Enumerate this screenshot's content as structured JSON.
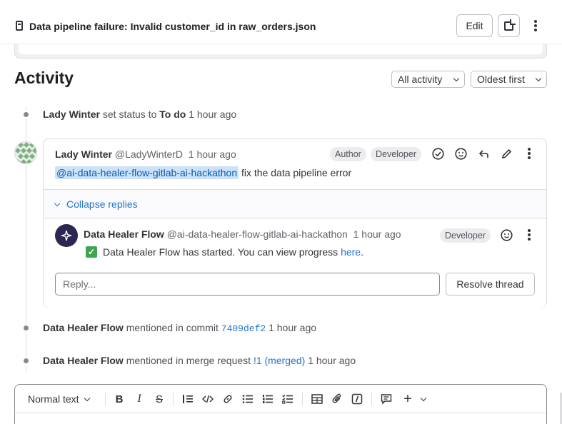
{
  "header": {
    "issue_title": "Data pipeline failure: Invalid customer_id in raw_orders.json",
    "edit_label": "Edit"
  },
  "activity": {
    "title": "Activity",
    "filter_value": "All activity",
    "sort_value": "Oldest first"
  },
  "timeline": {
    "status_note": {
      "author": "Lady Winter",
      "action": "set status to",
      "status": "To do",
      "time": "1 hour ago"
    },
    "discussion": {
      "author": "Lady Winter",
      "handle": "@LadyWinterD",
      "time": "1 hour ago",
      "badges": [
        "Author",
        "Developer"
      ],
      "mention": "@ai-data-healer-flow-gitlab-ai-hackathon",
      "body": "fix the data pipeline error",
      "collapse_label": "Collapse replies",
      "reply": {
        "author": "Data Healer Flow",
        "handle": "@ai-data-healer-flow-gitlab-ai-hackathon",
        "time": "1 hour ago",
        "badge": "Developer",
        "check": "✓",
        "body": "Data Healer Flow has started. You can view progress",
        "link": "here",
        "period": "."
      },
      "reply_placeholder": "Reply...",
      "resolve_label": "Resolve thread"
    },
    "commit_note": {
      "author": "Data Healer Flow",
      "action": "mentioned in commit",
      "commit": "7409def2",
      "time": "1 hour ago"
    },
    "mr_note": {
      "author": "Data Healer Flow",
      "action": "mentioned in merge request",
      "mr": "!1 (merged)",
      "time": "1 hour ago"
    }
  },
  "editor": {
    "text_style": "Normal text",
    "tools": [
      "bold-icon",
      "italic-icon",
      "strikethrough-icon",
      "blockquote-icon",
      "code-icon",
      "link-icon",
      "bullet-list-icon",
      "numbered-list-icon",
      "task-list-icon",
      "table-icon",
      "attach-icon",
      "more-formatting-icon",
      "comment-template-icon",
      "plus-icon"
    ]
  },
  "colors": {
    "link": "#1f75cb",
    "mention_bg": "#cbe2f9",
    "bot_avatar": "#2b2652",
    "check": "#3fa64e"
  }
}
